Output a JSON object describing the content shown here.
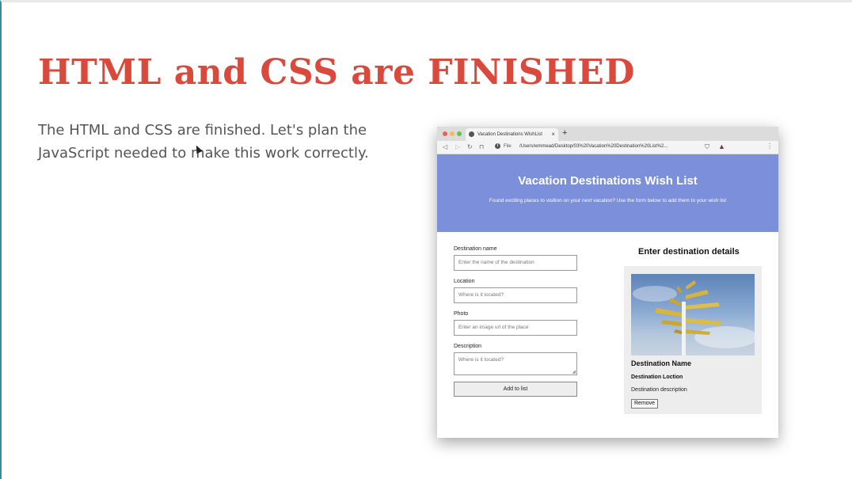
{
  "slide": {
    "title": "HTML and CSS are FINISHED",
    "body": "The HTML and CSS are finished. Let's plan the JavaScript needed to make this work correctly.",
    "title_color": "#d9493c"
  },
  "browser": {
    "tab_title": "Vacation Destinations WishList",
    "tab_close": "×",
    "new_tab": "+",
    "file_label": "File",
    "url": "/Users/wmmead/Desktop/03%20Vacation%20Destination%20List%2...",
    "icons": {
      "back": "back-icon",
      "forward": "forward-icon",
      "reload": "reload-icon",
      "bookmark": "bookmark-icon",
      "info": "info-icon",
      "shield": "shield-icon",
      "extension": "extension-icon",
      "menu": "menu-icon"
    }
  },
  "page": {
    "header": {
      "title": "Vacation Destinations Wish List",
      "subtitle": "Found exciting places to visition on your next vacation? Use the form below to add them to your wish list",
      "background": "#7b8fdb"
    },
    "form": {
      "name_label": "Destination name",
      "name_placeholder": "Enter the name of the destination",
      "location_label": "Location",
      "location_placeholder": "Where is it located?",
      "photo_label": "Photo",
      "photo_placeholder": "Enter an image url of the place",
      "description_label": "Description",
      "description_placeholder": "Where is it located?",
      "submit_label": "Add to list"
    },
    "details": {
      "heading": "Enter destination details",
      "card": {
        "name": "Destination Name",
        "location": "Destination Loction",
        "description": "Destination description",
        "remove_label": "Remove"
      }
    }
  }
}
